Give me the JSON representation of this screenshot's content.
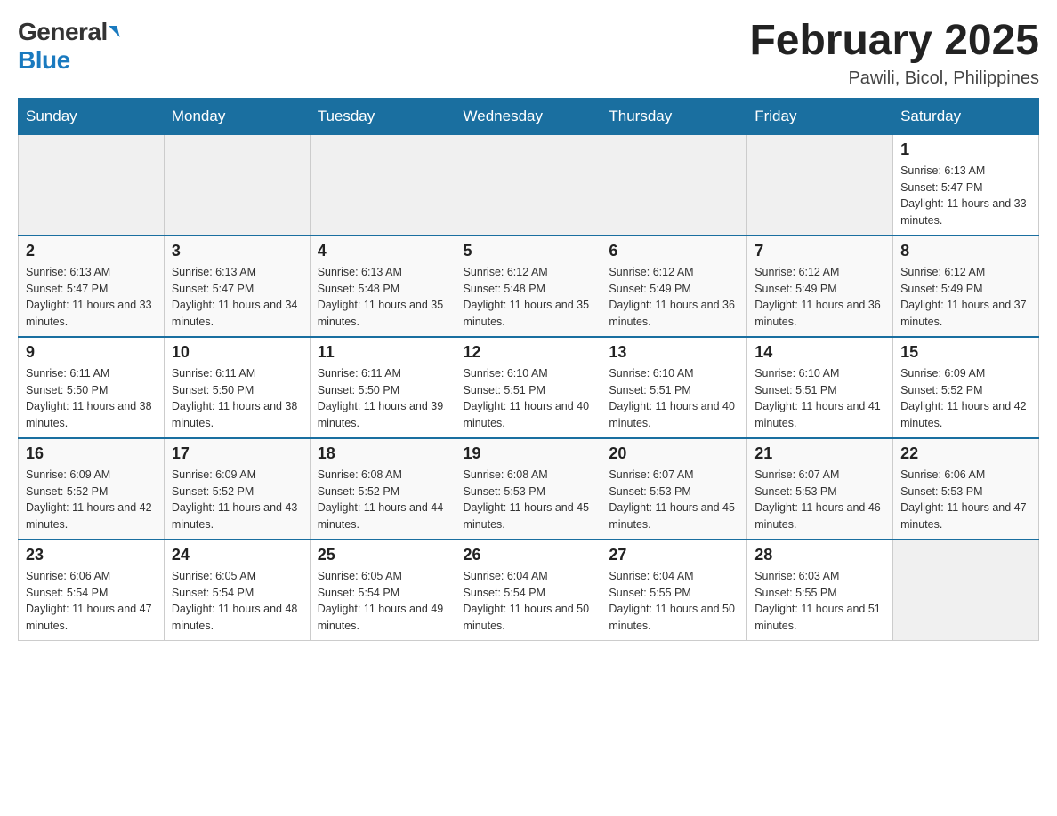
{
  "logo": {
    "general": "General",
    "blue": "Blue"
  },
  "title": "February 2025",
  "location": "Pawili, Bicol, Philippines",
  "weekdays": [
    "Sunday",
    "Monday",
    "Tuesday",
    "Wednesday",
    "Thursday",
    "Friday",
    "Saturday"
  ],
  "weeks": [
    [
      {
        "day": "",
        "sunrise": "",
        "sunset": "",
        "daylight": "",
        "empty": true
      },
      {
        "day": "",
        "sunrise": "",
        "sunset": "",
        "daylight": "",
        "empty": true
      },
      {
        "day": "",
        "sunrise": "",
        "sunset": "",
        "daylight": "",
        "empty": true
      },
      {
        "day": "",
        "sunrise": "",
        "sunset": "",
        "daylight": "",
        "empty": true
      },
      {
        "day": "",
        "sunrise": "",
        "sunset": "",
        "daylight": "",
        "empty": true
      },
      {
        "day": "",
        "sunrise": "",
        "sunset": "",
        "daylight": "",
        "empty": true
      },
      {
        "day": "1",
        "sunrise": "Sunrise: 6:13 AM",
        "sunset": "Sunset: 5:47 PM",
        "daylight": "Daylight: 11 hours and 33 minutes.",
        "empty": false
      }
    ],
    [
      {
        "day": "2",
        "sunrise": "Sunrise: 6:13 AM",
        "sunset": "Sunset: 5:47 PM",
        "daylight": "Daylight: 11 hours and 33 minutes.",
        "empty": false
      },
      {
        "day": "3",
        "sunrise": "Sunrise: 6:13 AM",
        "sunset": "Sunset: 5:47 PM",
        "daylight": "Daylight: 11 hours and 34 minutes.",
        "empty": false
      },
      {
        "day": "4",
        "sunrise": "Sunrise: 6:13 AM",
        "sunset": "Sunset: 5:48 PM",
        "daylight": "Daylight: 11 hours and 35 minutes.",
        "empty": false
      },
      {
        "day": "5",
        "sunrise": "Sunrise: 6:12 AM",
        "sunset": "Sunset: 5:48 PM",
        "daylight": "Daylight: 11 hours and 35 minutes.",
        "empty": false
      },
      {
        "day": "6",
        "sunrise": "Sunrise: 6:12 AM",
        "sunset": "Sunset: 5:49 PM",
        "daylight": "Daylight: 11 hours and 36 minutes.",
        "empty": false
      },
      {
        "day": "7",
        "sunrise": "Sunrise: 6:12 AM",
        "sunset": "Sunset: 5:49 PM",
        "daylight": "Daylight: 11 hours and 36 minutes.",
        "empty": false
      },
      {
        "day": "8",
        "sunrise": "Sunrise: 6:12 AM",
        "sunset": "Sunset: 5:49 PM",
        "daylight": "Daylight: 11 hours and 37 minutes.",
        "empty": false
      }
    ],
    [
      {
        "day": "9",
        "sunrise": "Sunrise: 6:11 AM",
        "sunset": "Sunset: 5:50 PM",
        "daylight": "Daylight: 11 hours and 38 minutes.",
        "empty": false
      },
      {
        "day": "10",
        "sunrise": "Sunrise: 6:11 AM",
        "sunset": "Sunset: 5:50 PM",
        "daylight": "Daylight: 11 hours and 38 minutes.",
        "empty": false
      },
      {
        "day": "11",
        "sunrise": "Sunrise: 6:11 AM",
        "sunset": "Sunset: 5:50 PM",
        "daylight": "Daylight: 11 hours and 39 minutes.",
        "empty": false
      },
      {
        "day": "12",
        "sunrise": "Sunrise: 6:10 AM",
        "sunset": "Sunset: 5:51 PM",
        "daylight": "Daylight: 11 hours and 40 minutes.",
        "empty": false
      },
      {
        "day": "13",
        "sunrise": "Sunrise: 6:10 AM",
        "sunset": "Sunset: 5:51 PM",
        "daylight": "Daylight: 11 hours and 40 minutes.",
        "empty": false
      },
      {
        "day": "14",
        "sunrise": "Sunrise: 6:10 AM",
        "sunset": "Sunset: 5:51 PM",
        "daylight": "Daylight: 11 hours and 41 minutes.",
        "empty": false
      },
      {
        "day": "15",
        "sunrise": "Sunrise: 6:09 AM",
        "sunset": "Sunset: 5:52 PM",
        "daylight": "Daylight: 11 hours and 42 minutes.",
        "empty": false
      }
    ],
    [
      {
        "day": "16",
        "sunrise": "Sunrise: 6:09 AM",
        "sunset": "Sunset: 5:52 PM",
        "daylight": "Daylight: 11 hours and 42 minutes.",
        "empty": false
      },
      {
        "day": "17",
        "sunrise": "Sunrise: 6:09 AM",
        "sunset": "Sunset: 5:52 PM",
        "daylight": "Daylight: 11 hours and 43 minutes.",
        "empty": false
      },
      {
        "day": "18",
        "sunrise": "Sunrise: 6:08 AM",
        "sunset": "Sunset: 5:52 PM",
        "daylight": "Daylight: 11 hours and 44 minutes.",
        "empty": false
      },
      {
        "day": "19",
        "sunrise": "Sunrise: 6:08 AM",
        "sunset": "Sunset: 5:53 PM",
        "daylight": "Daylight: 11 hours and 45 minutes.",
        "empty": false
      },
      {
        "day": "20",
        "sunrise": "Sunrise: 6:07 AM",
        "sunset": "Sunset: 5:53 PM",
        "daylight": "Daylight: 11 hours and 45 minutes.",
        "empty": false
      },
      {
        "day": "21",
        "sunrise": "Sunrise: 6:07 AM",
        "sunset": "Sunset: 5:53 PM",
        "daylight": "Daylight: 11 hours and 46 minutes.",
        "empty": false
      },
      {
        "day": "22",
        "sunrise": "Sunrise: 6:06 AM",
        "sunset": "Sunset: 5:53 PM",
        "daylight": "Daylight: 11 hours and 47 minutes.",
        "empty": false
      }
    ],
    [
      {
        "day": "23",
        "sunrise": "Sunrise: 6:06 AM",
        "sunset": "Sunset: 5:54 PM",
        "daylight": "Daylight: 11 hours and 47 minutes.",
        "empty": false
      },
      {
        "day": "24",
        "sunrise": "Sunrise: 6:05 AM",
        "sunset": "Sunset: 5:54 PM",
        "daylight": "Daylight: 11 hours and 48 minutes.",
        "empty": false
      },
      {
        "day": "25",
        "sunrise": "Sunrise: 6:05 AM",
        "sunset": "Sunset: 5:54 PM",
        "daylight": "Daylight: 11 hours and 49 minutes.",
        "empty": false
      },
      {
        "day": "26",
        "sunrise": "Sunrise: 6:04 AM",
        "sunset": "Sunset: 5:54 PM",
        "daylight": "Daylight: 11 hours and 50 minutes.",
        "empty": false
      },
      {
        "day": "27",
        "sunrise": "Sunrise: 6:04 AM",
        "sunset": "Sunset: 5:55 PM",
        "daylight": "Daylight: 11 hours and 50 minutes.",
        "empty": false
      },
      {
        "day": "28",
        "sunrise": "Sunrise: 6:03 AM",
        "sunset": "Sunset: 5:55 PM",
        "daylight": "Daylight: 11 hours and 51 minutes.",
        "empty": false
      },
      {
        "day": "",
        "sunrise": "",
        "sunset": "",
        "daylight": "",
        "empty": true
      }
    ]
  ]
}
